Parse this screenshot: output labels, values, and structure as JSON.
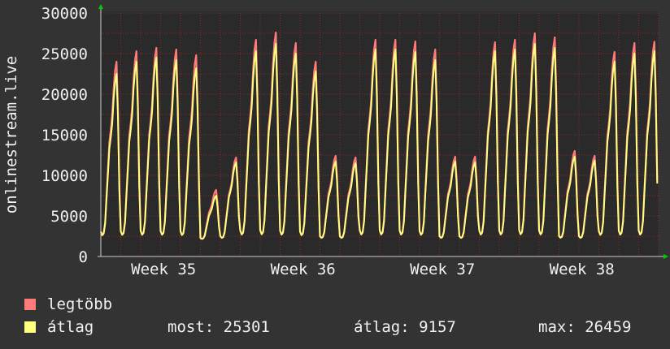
{
  "chart_data": {
    "type": "area",
    "ylabel": "onlinestream.live",
    "ylim": [
      0,
      30000
    ],
    "y_ticks": [
      0,
      5000,
      10000,
      15000,
      20000,
      25000,
      30000
    ],
    "x_tick_labels": [
      "Week 35",
      "Week 36",
      "Week 37",
      "Week 38"
    ],
    "grid": true,
    "series": [
      {
        "name": "legtöbb",
        "color": "#ff7a7a"
      },
      {
        "name": "átlag",
        "color": "#ffff80"
      }
    ],
    "gap_days": [
      5,
      6
    ],
    "daily_peaks_max": [
      24000,
      25300,
      25700,
      25500,
      24800,
      8200,
      12200,
      26700,
      27600,
      26300,
      24000,
      12400,
      12200,
      26700,
      26700,
      26500,
      25500,
      12300,
      12300,
      26400,
      26700,
      27500,
      27000,
      13000,
      12400,
      25200,
      26300,
      26459
    ],
    "daily_peaks_avg": [
      22500,
      24000,
      24500,
      24200,
      23200,
      7500,
      11600,
      25300,
      26200,
      25000,
      22800,
      11700,
      11500,
      25500,
      25500,
      25200,
      24200,
      11700,
      11600,
      25300,
      25500,
      26200,
      25700,
      12300,
      11800,
      24000,
      25000,
      25301
    ],
    "daily_min": 2000
  },
  "legend": [
    {
      "label": "legtöbb",
      "color": "#ff7a7a"
    },
    {
      "label": "átlag",
      "color": "#ffff80"
    }
  ],
  "stats": {
    "current": "most: 25301",
    "average": "átlag: 9157",
    "max": "max: 26459"
  },
  "colors": {
    "background": "#333333",
    "plot_background": "#2a2a2a",
    "grid": "#8a2a2a",
    "text": "#f0f0f0",
    "arrow": "#00cc00"
  }
}
